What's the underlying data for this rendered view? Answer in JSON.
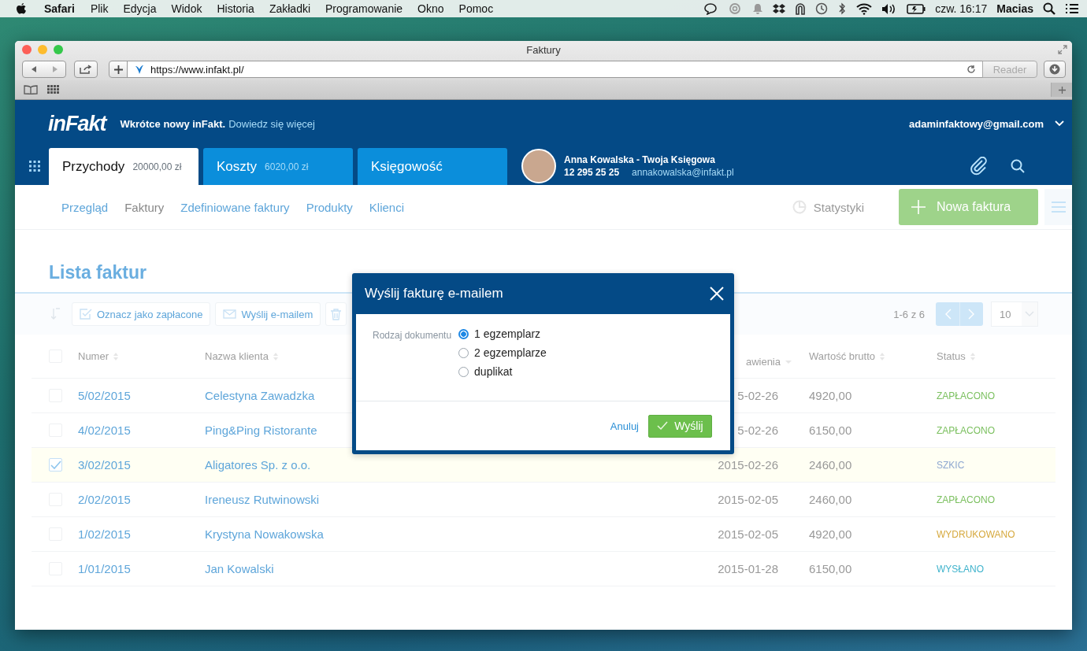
{
  "menubar": {
    "app": "Safari",
    "items": [
      "Plik",
      "Edycja",
      "Widok",
      "Historia",
      "Zakładki",
      "Programowanie",
      "Okno",
      "Pomoc"
    ],
    "clock": "czw. 16:17",
    "user": "Macias"
  },
  "browser": {
    "title": "Faktury",
    "url": "https://www.infakt.pl/",
    "reader": "Reader"
  },
  "header": {
    "logo": "inFakt",
    "announcement": "Wkrótce nowy inFakt.",
    "announcement_link": "Dowiedz się więcej",
    "account": "adaminfaktowy@gmail.com",
    "tabs": [
      {
        "label": "Przychody",
        "amount": "20000,00 zł",
        "selected": true
      },
      {
        "label": "Koszty",
        "amount": "6020,00 zł",
        "selected": false
      },
      {
        "label": "Księgowość",
        "selected": false
      }
    ],
    "accountant": {
      "name": "Anna Kowalska - Twoja Księgowa",
      "phone": "12 295 25 25",
      "email": "annakowalska@infakt.pl"
    }
  },
  "subnav": {
    "items": [
      {
        "label": "Przegląd",
        "selected": false
      },
      {
        "label": "Faktury",
        "selected": true
      },
      {
        "label": "Zdefiniowane faktury",
        "selected": false
      },
      {
        "label": "Produkty",
        "selected": false
      },
      {
        "label": "Klienci",
        "selected": false
      }
    ],
    "stats": "Statystyki",
    "new_button": "Nowa faktura"
  },
  "page_title": "Lista faktur",
  "toolbar": {
    "actions": [
      {
        "kind": "check",
        "label": "Oznacz jako zapłacone"
      },
      {
        "kind": "mail",
        "label": "Wyślij e-mailem"
      },
      {
        "kind": "delete"
      }
    ],
    "range": "1-6 z 6",
    "per_page": "10"
  },
  "table": {
    "select_all": {
      "checked": false
    },
    "columns": [
      {
        "label": "Numer",
        "kind": "sortable"
      },
      {
        "label": "Nazwa klienta",
        "kind": "sortable"
      },
      {
        "label": "awienia",
        "kind": "sorted"
      },
      {
        "label": "Wartość brutto",
        "kind": "sortable"
      },
      {
        "label": "Status",
        "kind": "sortable"
      }
    ],
    "rows": [
      {
        "selected": false,
        "checked": false,
        "number": "5/02/2015",
        "client": "Celestyna Zawadzka",
        "date": "5-02-26",
        "amount": "4920,00",
        "status": "ZAPŁACONO",
        "color": "#7cc060"
      },
      {
        "selected": false,
        "checked": false,
        "number": "4/02/2015",
        "client": "Ping&Ping Ristorante",
        "date": "5-02-26",
        "amount": "6150,00",
        "status": "ZAPŁACONO",
        "color": "#7cc060"
      },
      {
        "selected": true,
        "checked": true,
        "number": "3/02/2015",
        "client": "Aligatores Sp. z o.o.",
        "date": "2015-02-26",
        "amount": "2460,00",
        "status": "SZKIC",
        "color": "#8fa8d0"
      },
      {
        "selected": false,
        "checked": false,
        "number": "2/02/2015",
        "client": "Ireneusz Rutwinowski",
        "date": "2015-02-05",
        "amount": "2460,00",
        "status": "ZAPŁACONO",
        "color": "#7cc060"
      },
      {
        "selected": false,
        "checked": false,
        "number": "1/02/2015",
        "client": "Krystyna Nowakowska",
        "date": "2015-02-05",
        "amount": "4920,00",
        "status": "WYDRUKOWANO",
        "color": "#d6a93e"
      },
      {
        "selected": false,
        "checked": false,
        "number": "1/01/2015",
        "client": "Jan Kowalski",
        "date": "2015-01-28",
        "amount": "6150,00",
        "status": "WYSŁANO",
        "color": "#3fb3cc"
      }
    ]
  },
  "modal": {
    "title": "Wyślij fakturę e-mailem",
    "field_label": "Rodzaj dokumentu",
    "options": [
      {
        "label": "1 egzemplarz",
        "selected": true
      },
      {
        "label": "2 egzemplarze",
        "selected": false
      },
      {
        "label": "duplikat",
        "selected": false
      }
    ],
    "cancel": "Anuluj",
    "submit": "Wyślij"
  }
}
